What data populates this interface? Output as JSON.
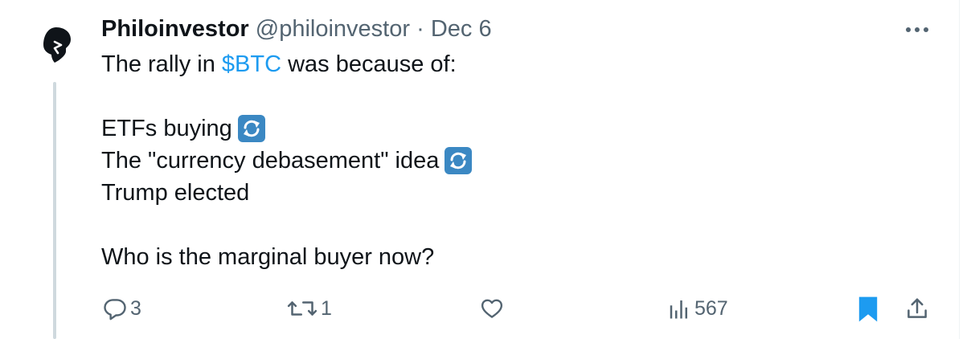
{
  "author": {
    "display_name": "Philoinvestor",
    "handle": "@philoinvestor",
    "separator": "·",
    "date": "Dec 6"
  },
  "tweet": {
    "line1_prefix": "The rally in ",
    "cashtag": "$BTC",
    "line1_suffix": " was because of:",
    "item1": "ETFs buying",
    "item2": "The \"currency debasement\" idea",
    "item3": "Trump elected",
    "question": "Who is the marginal buyer now?",
    "emoji_icon": "repeat-emoji-icon"
  },
  "actions": {
    "replies": "3",
    "reposts": "1",
    "views": "567"
  },
  "colors": {
    "accent": "#1d9bf0",
    "text": "#0f1419",
    "muted": "#536471",
    "thread_line": "#cfd9de"
  }
}
